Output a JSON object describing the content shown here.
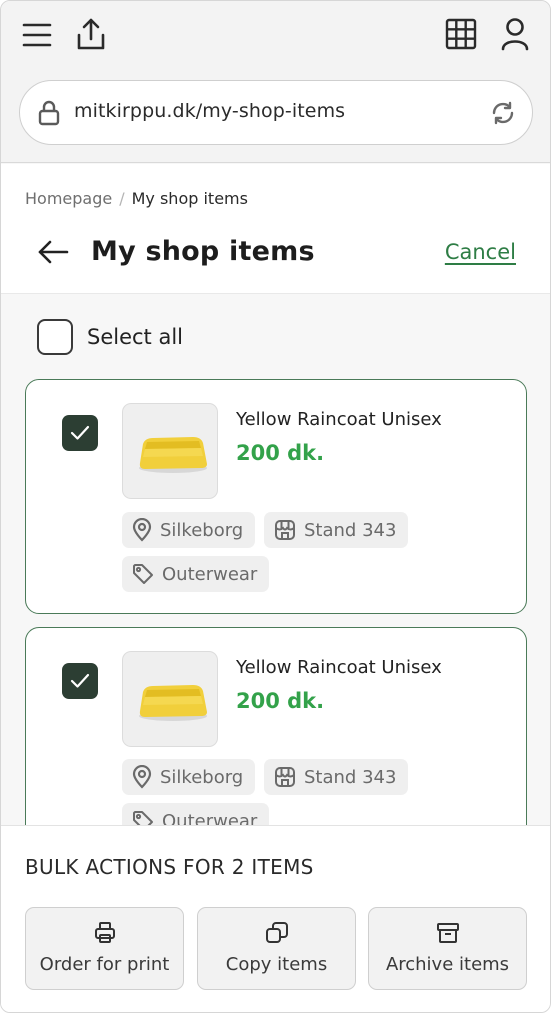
{
  "browser": {
    "url": "mitkirppu.dk/my-shop-items",
    "icons": [
      "menu-icon",
      "share-icon",
      "grid-icon",
      "account-icon",
      "lock-icon",
      "reload-icon"
    ]
  },
  "breadcrumb": {
    "home": "Homepage",
    "separator": "/",
    "current": "My shop items"
  },
  "header": {
    "title": "My shop items",
    "cancel_label": "Cancel"
  },
  "select_all": {
    "label": "Select all",
    "checked": false
  },
  "items": [
    {
      "name": "Yellow Raincoat Unisex",
      "price": "200 dk.",
      "checked": true,
      "location": "Silkeborg",
      "stand": "Stand 343",
      "category": "Outerwear"
    },
    {
      "name": "Yellow Raincoat Unisex",
      "price": "200 dk.",
      "checked": true,
      "location": "Silkeborg",
      "stand": "Stand 343",
      "category": "Outerwear"
    }
  ],
  "bulk": {
    "heading": "BULK ACTIONS FOR 2 ITEMS",
    "actions": [
      {
        "label": "Order for print",
        "icon": "printer-icon"
      },
      {
        "label": "Copy items",
        "icon": "copy-icon"
      },
      {
        "label": "Archive items",
        "icon": "archive-icon"
      }
    ]
  },
  "colors": {
    "accent_green": "#33a24a",
    "card_border": "#4a7a58",
    "checkbox_fill": "#2c3e33"
  }
}
